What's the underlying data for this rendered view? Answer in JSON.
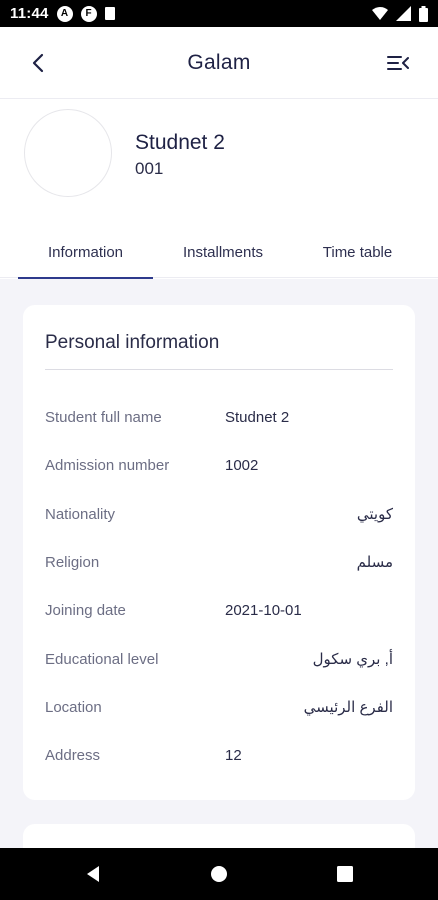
{
  "status_bar": {
    "time": "11:44",
    "notif_a": "A",
    "notif_b": "F"
  },
  "header": {
    "title": "Galam",
    "back_icon": "chevron-left-icon",
    "menu_icon": "menu-collapse-icon"
  },
  "profile": {
    "name": "Studnet 2",
    "code": "001"
  },
  "tabs": [
    {
      "label": "Information",
      "active": true
    },
    {
      "label": "Installments",
      "active": false
    },
    {
      "label": "Time table",
      "active": false
    }
  ],
  "personal_info": {
    "title": "Personal information",
    "rows": [
      {
        "label": "Student full name",
        "value": "Studnet 2"
      },
      {
        "label": "Admission number",
        "value": "1002"
      },
      {
        "label": "Nationality",
        "value": "كويتي"
      },
      {
        "label": "Religion",
        "value": "مسلم"
      },
      {
        "label": "Joining date",
        "value": "2021-10-01"
      },
      {
        "label": "Educational level",
        "value": "أ, بري سكول"
      },
      {
        "label": "Location",
        "value": "الفرع الرئيسي"
      },
      {
        "label": "Address",
        "value": "12"
      }
    ]
  },
  "colors": {
    "accent": "#2e3a8c",
    "text_dark": "#1e2144",
    "background": "#f4f4f9"
  }
}
